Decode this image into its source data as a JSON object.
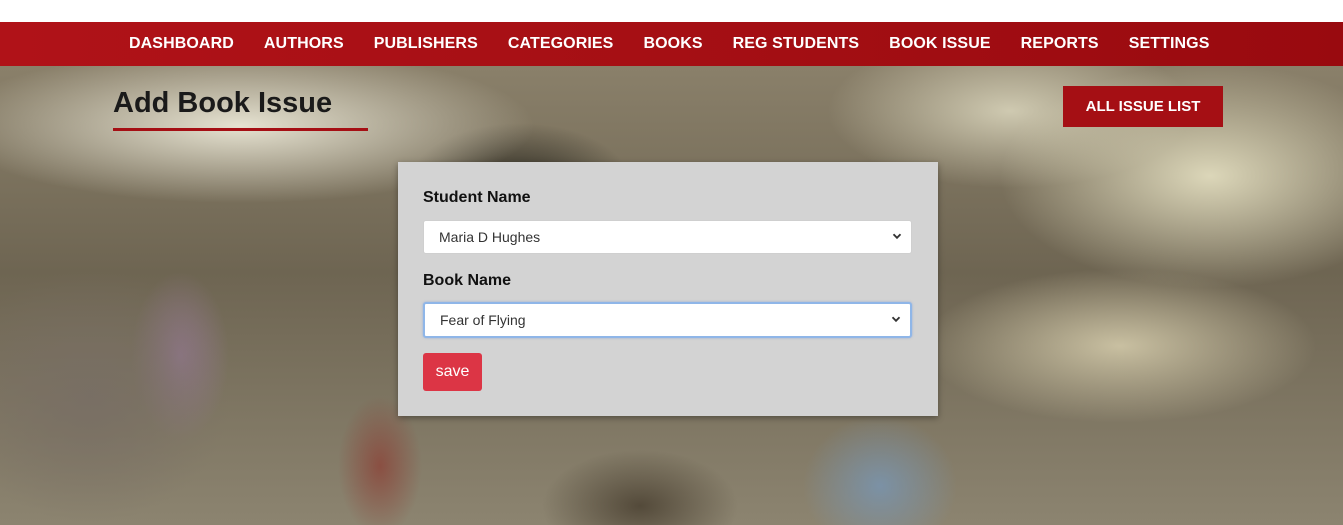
{
  "nav": {
    "items": [
      {
        "label": "DASHBOARD"
      },
      {
        "label": "AUTHORS"
      },
      {
        "label": "PUBLISHERS"
      },
      {
        "label": "CATEGORIES"
      },
      {
        "label": "BOOKS"
      },
      {
        "label": "REG STUDENTS"
      },
      {
        "label": "BOOK ISSUE"
      },
      {
        "label": "REPORTS"
      },
      {
        "label": "SETTINGS"
      }
    ]
  },
  "page": {
    "title": "Add Book Issue",
    "all_issue_button": "ALL ISSUE LIST"
  },
  "form": {
    "student": {
      "label": "Student Name",
      "value": "Maria D Hughes"
    },
    "book": {
      "label": "Book Name",
      "value": "Fear of Flying"
    },
    "save_label": "save"
  },
  "icons": {
    "select_arrow": "chevron-down-icon"
  },
  "colors": {
    "brand_red": "#a50f14",
    "save_button": "#dc3545",
    "card_bg": "#d3d3d3",
    "focus_ring": "#8fb6e8"
  }
}
